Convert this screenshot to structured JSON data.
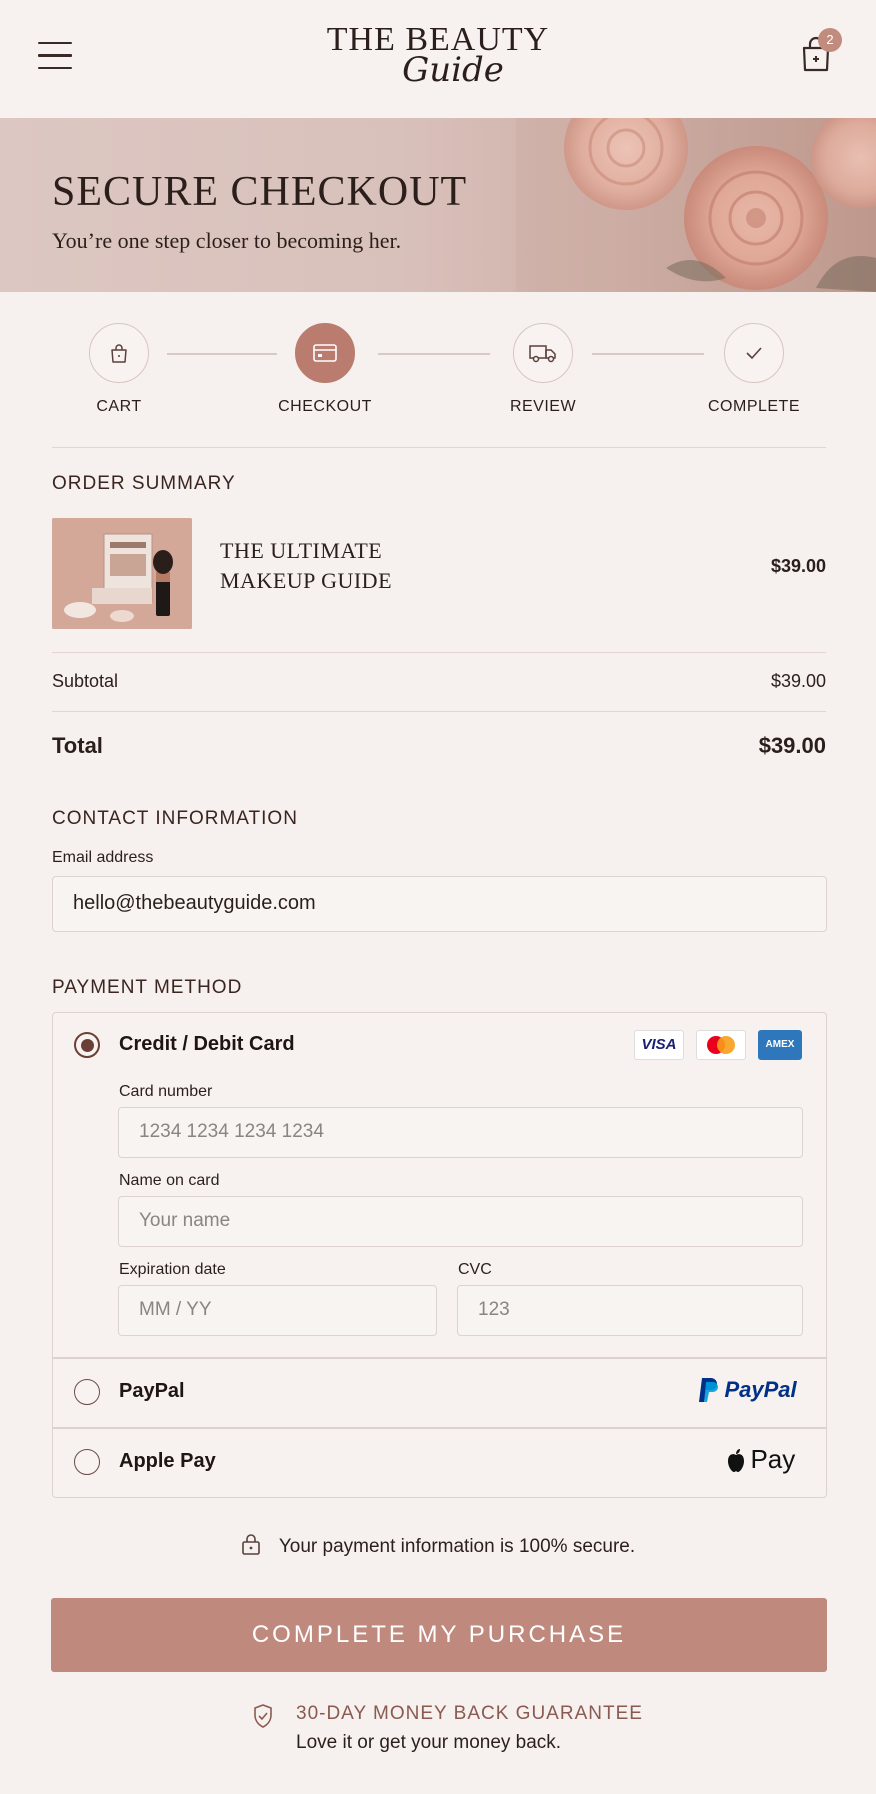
{
  "header": {
    "logo_top": "THE BEAUTY",
    "logo_script": "Guide",
    "cart_count": "2"
  },
  "hero": {
    "title": "SECURE CHECKOUT",
    "subtitle": "You’re one step closer to becoming her."
  },
  "steps": [
    {
      "label": "CART",
      "icon": "bag-icon"
    },
    {
      "label": "CHECKOUT",
      "icon": "card-icon"
    },
    {
      "label": "REVIEW",
      "icon": "truck-icon"
    },
    {
      "label": "COMPLETE",
      "icon": "check-icon"
    }
  ],
  "order": {
    "title": "ORDER SUMMARY",
    "item_name_line1": "THE ULTIMATE",
    "item_name_line2": "MAKEUP GUIDE",
    "item_price": "$39.00",
    "subtotal_label": "Subtotal",
    "subtotal_value": "$39.00",
    "total_label": "Total",
    "total_value": "$39.00"
  },
  "contact": {
    "title": "CONTACT INFORMATION",
    "email_label": "Email address",
    "email_value": "hello@thebeautyguide.com"
  },
  "payment": {
    "title": "PAYMENT METHOD",
    "card_label": "Credit / Debit Card",
    "card_number_label": "Card number",
    "card_number_placeholder": "1234 1234 1234 1234",
    "name_label": "Name on card",
    "name_placeholder": "Your name",
    "exp_label": "Expiration date",
    "exp_placeholder": "MM / YY",
    "cvc_label": "CVC",
    "cvc_placeholder": "123",
    "paypal_label": "PayPal",
    "paypal_logo": "PayPal",
    "applepay_label": "Apple Pay",
    "applepay_logo": "Pay",
    "visa_logo": "VISA",
    "amex_logo": "AMEX"
  },
  "secure_text": "Your payment information is 100% secure.",
  "cta_label": "COMPLETE MY PURCHASE",
  "guarantee": {
    "title": "30-DAY MONEY BACK GUARANTEE",
    "subtitle": "Love it or get your money back."
  },
  "colors": {
    "accent": "#bf8a7d",
    "active_step": "#b97c6f",
    "background": "#f6f0ee"
  }
}
